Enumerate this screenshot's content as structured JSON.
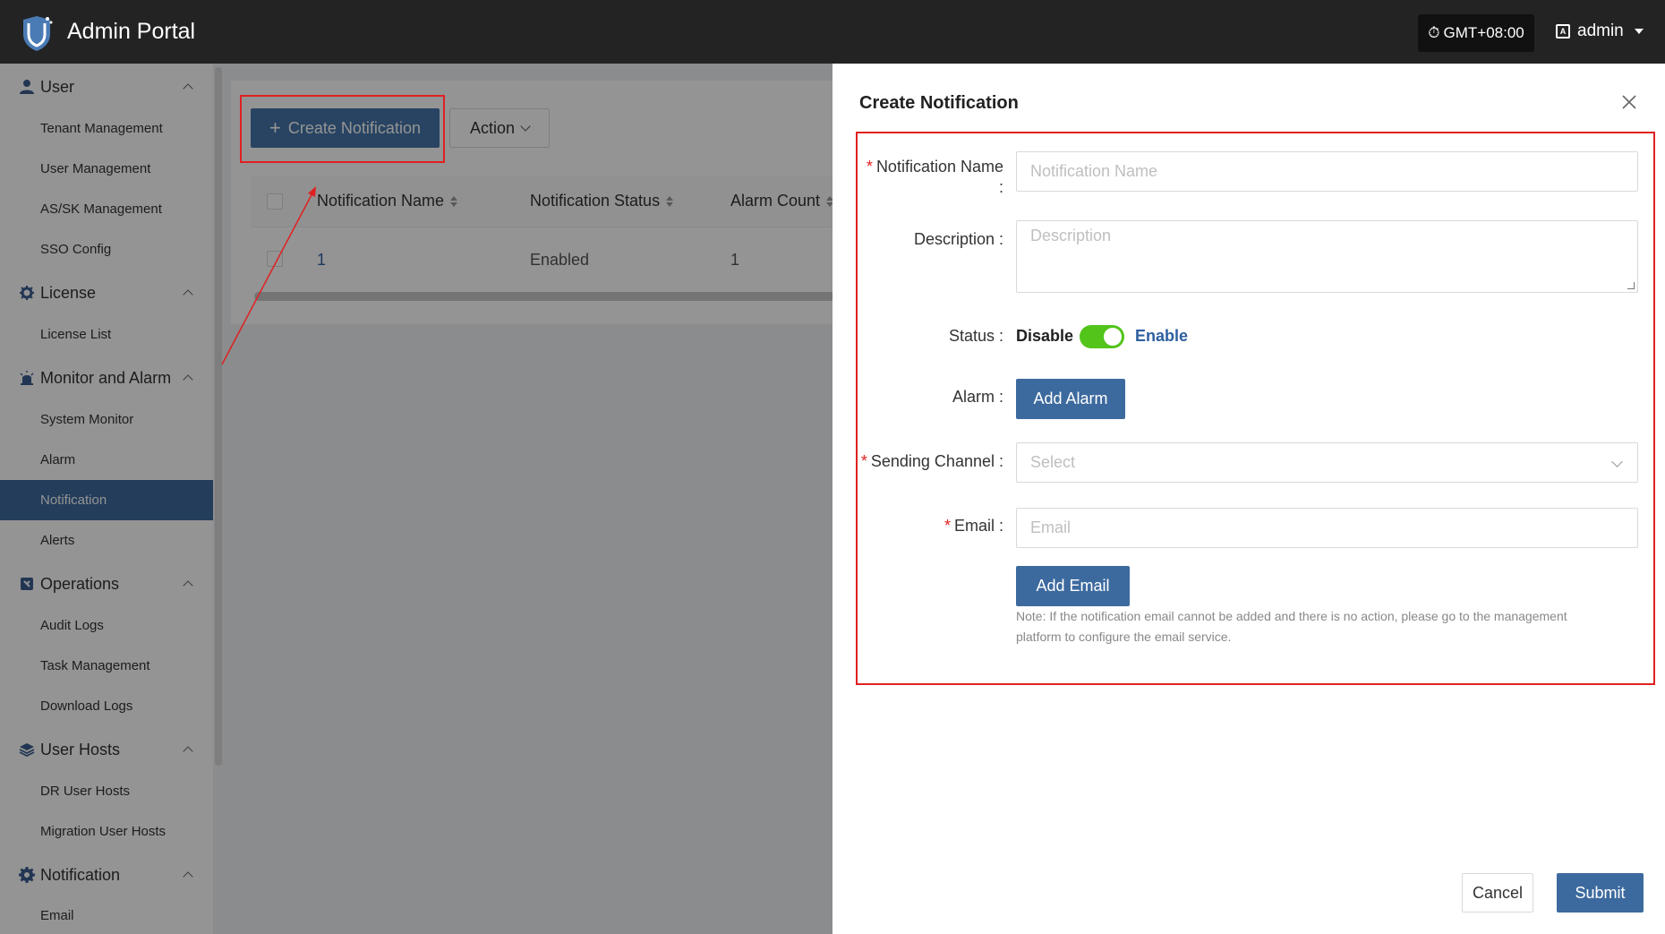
{
  "header": {
    "app_title": "Admin Portal",
    "timezone": "GMT+08:00",
    "user": "admin"
  },
  "sidebar": {
    "groups": [
      {
        "label": "User",
        "icon": "user-icon",
        "items": [
          "Tenant Management",
          "User Management",
          "AS/SK Management",
          "SSO Config"
        ]
      },
      {
        "label": "License",
        "icon": "license-icon",
        "items": [
          "License List"
        ]
      },
      {
        "label": "Monitor and Alarm",
        "icon": "monitor-icon",
        "items": [
          "System Monitor",
          "Alarm",
          "Notification",
          "Alerts"
        ]
      },
      {
        "label": "Operations",
        "icon": "operations-icon",
        "items": [
          "Audit Logs",
          "Task Management",
          "Download Logs"
        ]
      },
      {
        "label": "User Hosts",
        "icon": "layers-icon",
        "items": [
          "DR User Hosts",
          "Migration User Hosts"
        ]
      },
      {
        "label": "Notification",
        "icon": "gear-icon",
        "items": [
          "Email"
        ]
      }
    ],
    "active_item": "Notification"
  },
  "toolbar": {
    "create_label": "Create Notification",
    "action_label": "Action"
  },
  "table": {
    "columns": [
      "Notification Name",
      "Notification Status",
      "Alarm Count"
    ],
    "rows": [
      {
        "name": "1",
        "status": "Enabled",
        "alarm_count": "1"
      }
    ]
  },
  "drawer": {
    "title": "Create Notification",
    "fields": {
      "name_label": "Notification Name",
      "name_colon": ":",
      "name_placeholder": "Notification Name",
      "description_label": "Description :",
      "description_placeholder": "Description",
      "status_label": "Status :",
      "status_off": "Disable",
      "status_on": "Enable",
      "status_enabled": true,
      "alarm_label": "Alarm :",
      "add_alarm": "Add Alarm",
      "channel_label": "Sending Channel :",
      "channel_placeholder": "Select",
      "email_label": "Email :",
      "email_placeholder": "Email",
      "add_email": "Add Email",
      "note_line1": "Note: If the notification email cannot be added and there is no action, please go to the management",
      "note_line2": "platform to configure the email service."
    },
    "cancel": "Cancel",
    "submit": "Submit"
  },
  "colors": {
    "primary": "#3d6a9e",
    "highlight": "#e02020",
    "toggle_on": "#52c41a"
  }
}
